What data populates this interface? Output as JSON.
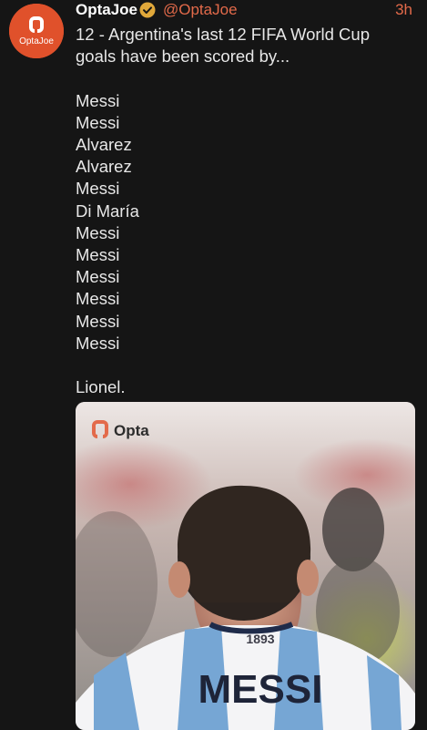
{
  "tweet": {
    "display_name": "OptaJoe",
    "handle": "@OptaJoe",
    "timestamp": "3h",
    "avatar_label": "OptaJoe",
    "verified": true,
    "text_lines": [
      "12 - Argentina's last 12 FIFA World Cup",
      "goals have been scored by...",
      "",
      "Messi",
      "Messi",
      "Alvarez",
      "Alvarez",
      "Messi",
      "Di María",
      "Messi",
      "Messi",
      "Messi",
      "Messi",
      "Messi",
      "Messi",
      "",
      "Lionel."
    ],
    "media": {
      "brand_logo_text": "Opta",
      "shirt_number_text": "1893",
      "shirt_name_text": "MESSI"
    }
  },
  "colors": {
    "background": "#151515",
    "accent": "#e36a4a",
    "text": "#e7e7e7",
    "avatar_bg": "#e0512b",
    "verified_badge": "#e0a83a"
  }
}
